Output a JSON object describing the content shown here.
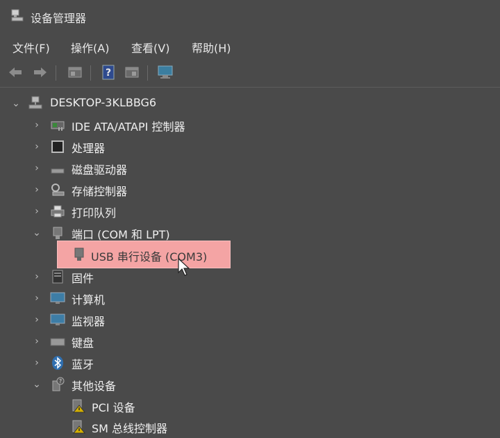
{
  "window": {
    "title": "设备管理器",
    "title_icon": "device-manager-icon"
  },
  "menu": [
    {
      "label": "文件(F)"
    },
    {
      "label": "操作(A)"
    },
    {
      "label": "查看(V)"
    },
    {
      "label": "帮助(H)"
    }
  ],
  "toolbar": {
    "buttons": [
      "back-icon",
      "forward-icon",
      "properties-icon",
      "help-icon",
      "view-icon",
      "monitor-icon"
    ]
  },
  "tree": {
    "root": {
      "label": "DESKTOP-3KLBBG6",
      "expanded": true
    },
    "items": [
      {
        "label": "IDE ATA/ATAPI 控制器",
        "icon": "ide-controller-icon",
        "expanded": false
      },
      {
        "label": "处理器",
        "icon": "processor-icon",
        "expanded": false
      },
      {
        "label": "磁盘驱动器",
        "icon": "disk-drive-icon",
        "expanded": false
      },
      {
        "label": "存储控制器",
        "icon": "storage-controller-icon",
        "expanded": false
      },
      {
        "label": "打印队列",
        "icon": "printer-icon",
        "expanded": false
      },
      {
        "label": "端口 (COM 和 LPT)",
        "icon": "port-icon",
        "expanded": true
      },
      {
        "label": "USB 串行设备 (COM3)",
        "icon": "usb-serial-icon",
        "child": true,
        "selected": true
      },
      {
        "label": "固件",
        "icon": "firmware-icon",
        "expanded": false
      },
      {
        "label": "计算机",
        "icon": "computer-icon",
        "expanded": false
      },
      {
        "label": "监视器",
        "icon": "monitor-icon",
        "expanded": false
      },
      {
        "label": "键盘",
        "icon": "keyboard-icon",
        "expanded": false
      },
      {
        "label": "蓝牙",
        "icon": "bluetooth-icon",
        "expanded": false
      },
      {
        "label": "其他设备",
        "icon": "other-devices-icon",
        "expanded": true
      },
      {
        "label": "PCI 设备",
        "icon": "warning-device-icon",
        "child": true
      },
      {
        "label": "SM 总线控制器",
        "icon": "warning-device-icon",
        "child": true
      }
    ]
  },
  "colors": {
    "background": "#4a4a4a",
    "selection": "#f4a4a4",
    "text": "#efefef"
  }
}
